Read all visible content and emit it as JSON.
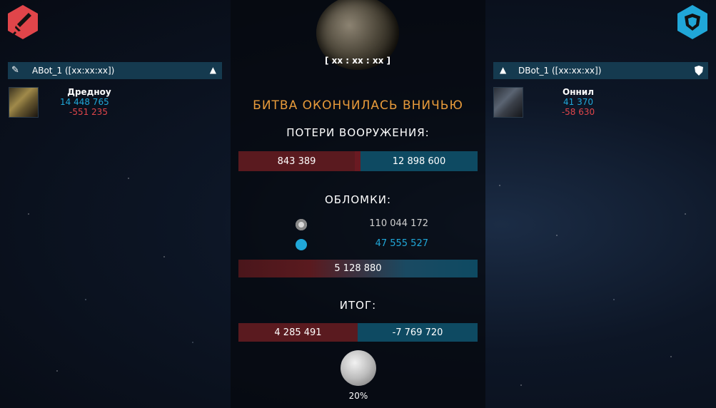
{
  "attacker": {
    "name": "ABot_1 ([xx:xx:xx])",
    "ship": "Дредноу",
    "count": "14 448 765",
    "loss": "-551 235"
  },
  "defender": {
    "name": "DBot_1 ([xx:xx:xx])",
    "ship": "Оннил",
    "count": "41 370",
    "loss": "-58 630"
  },
  "coords": "[ xx : xx : xx ]",
  "result_title": "БИТВА ОКОНЧИЛАСЬ ВНИЧЬЮ",
  "losses": {
    "title": "ПОТЕРИ ВООРУЖЕНИЯ:",
    "attacker": "843 389",
    "defender": "12 898 600"
  },
  "debris": {
    "title": "ОБЛОМКИ:",
    "metal": "110 044 172",
    "crystal": "47 555 527",
    "total": "5 128 880"
  },
  "result": {
    "title": "ИТОГ:",
    "attacker": "4 285 491",
    "defender": "-7 769 720"
  },
  "moon_chance": "20%",
  "colors": {
    "accent_orange": "#e79a3a",
    "attacker_red": "#e0454a",
    "defender_blue": "#20a7d8"
  }
}
